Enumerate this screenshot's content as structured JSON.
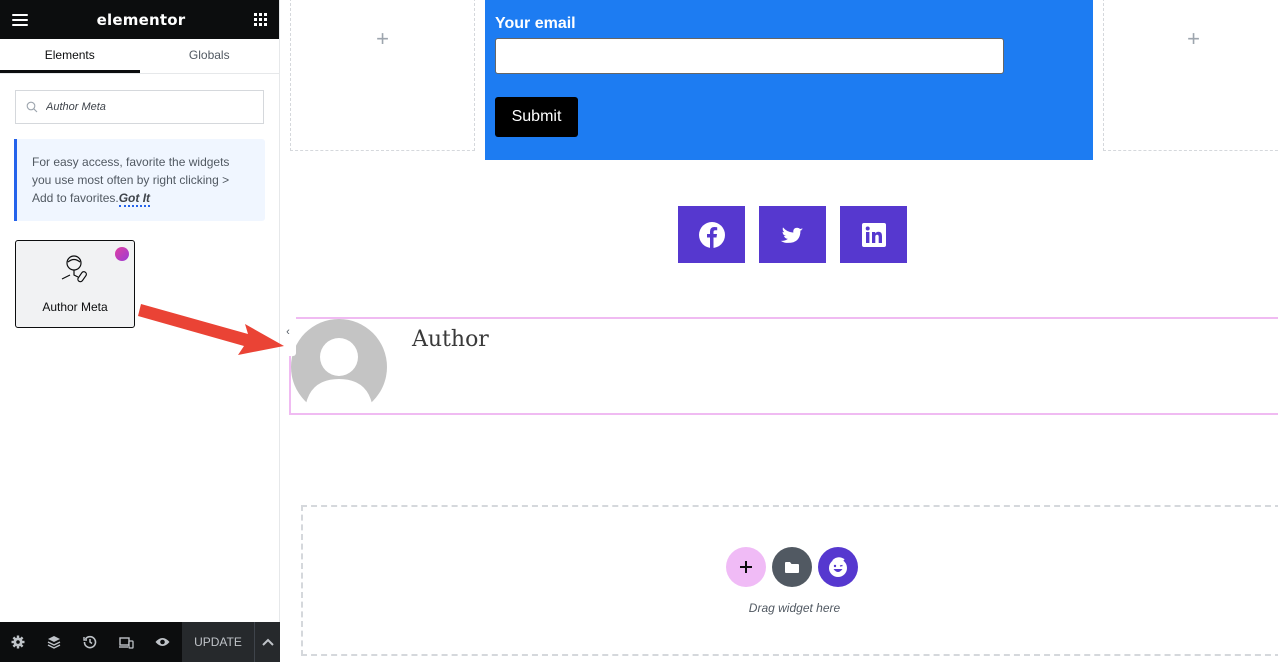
{
  "editor": {
    "logo": "elementor",
    "tabs": [
      {
        "label": "Elements",
        "active": true
      },
      {
        "label": "Globals",
        "active": false
      }
    ],
    "search": {
      "value": "Author Meta",
      "placeholder": "Search Widget..."
    },
    "notice": {
      "text": "For easy access, favorite the widgets you use most often by right clicking > Add to favorites.",
      "link": "Got It"
    },
    "widget": {
      "label": "Author Meta",
      "icon": "author-meta-icon",
      "badge": "pro-badge"
    },
    "footer": {
      "icons": [
        "settings-icon",
        "navigator-layers-icon",
        "history-icon",
        "responsive-mode-icon",
        "preview-eye-icon"
      ],
      "update_label": "UPDATE"
    }
  },
  "canvas": {
    "form": {
      "email_label": "Your email",
      "email_value": "",
      "submit_label": "Submit",
      "bg_color": "#1d7cf2"
    },
    "social": [
      {
        "name": "facebook",
        "icon": "facebook-icon"
      },
      {
        "name": "twitter",
        "icon": "twitter-icon"
      },
      {
        "name": "linkedin",
        "icon": "linkedin-icon"
      }
    ],
    "social_color": "#5638cf",
    "author": {
      "name": "Author"
    },
    "drop_zone": {
      "label": "Drag widget here"
    },
    "add_symbol": "+",
    "collapse_symbol": "‹"
  }
}
